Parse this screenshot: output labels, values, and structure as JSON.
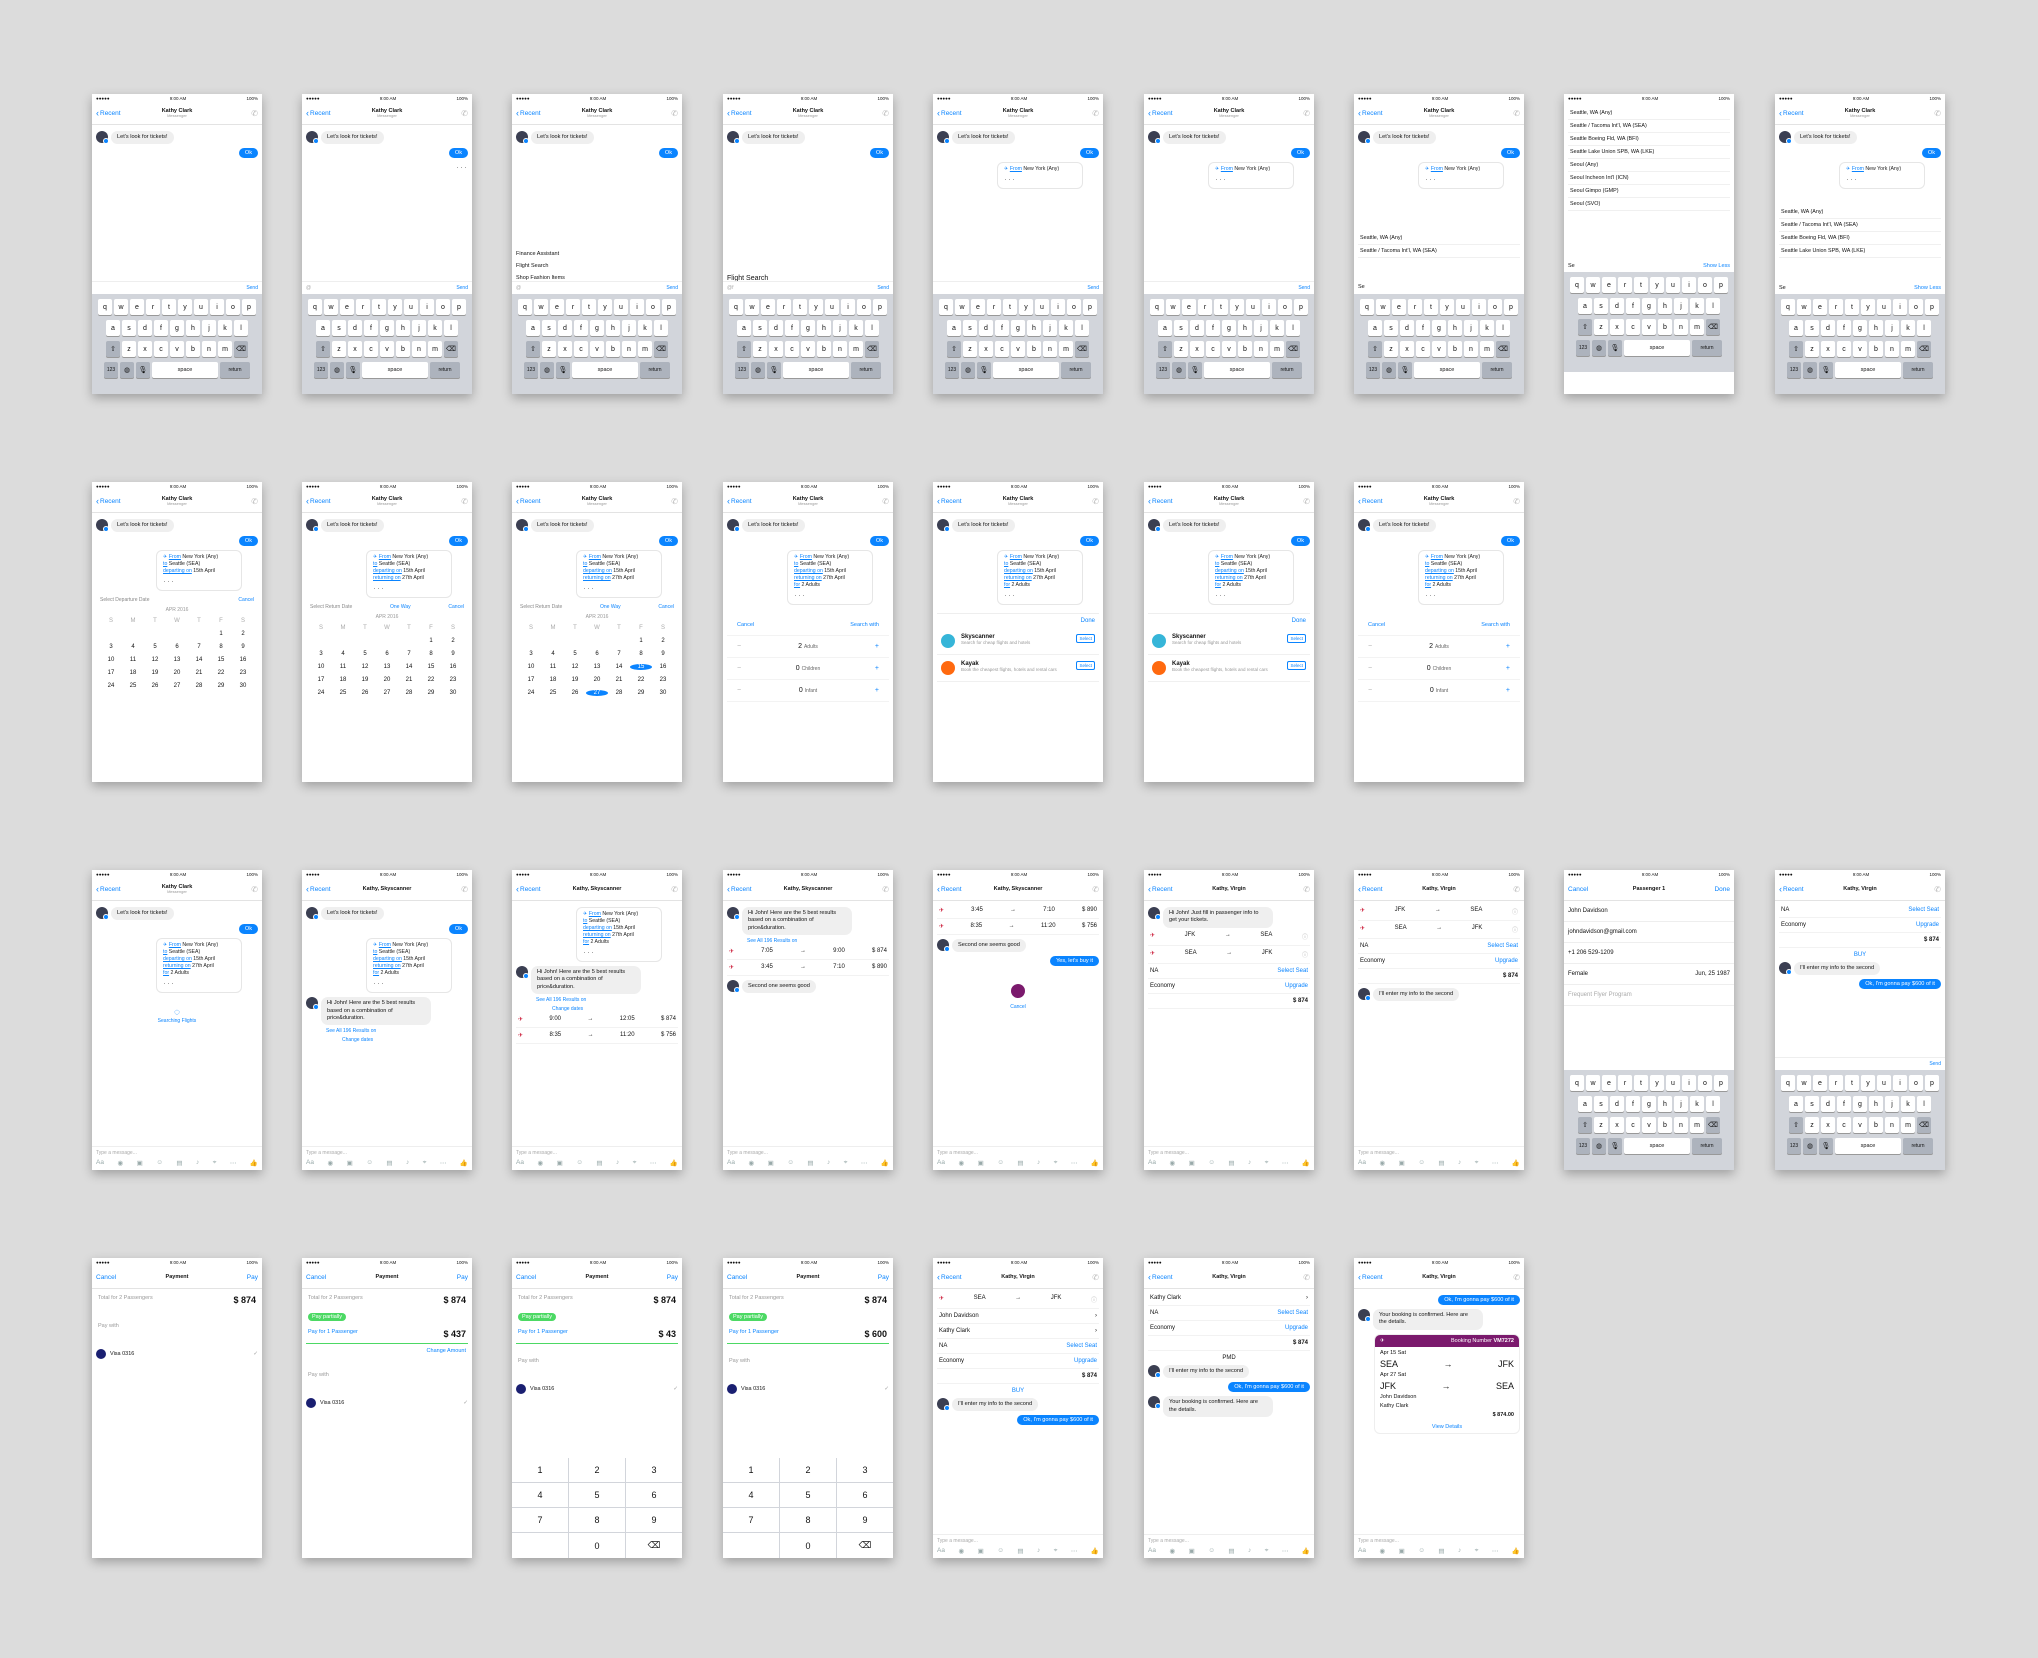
{
  "status": {
    "time": "9:00 AM",
    "battery": "100%"
  },
  "common": {
    "back": "Recent",
    "contact": "Kathy Clark",
    "contact_sub": "Messenger",
    "greeting": "Let's look for tickets!",
    "ok": "Ok",
    "send": "Send",
    "cancel": "Cancel",
    "done": "Done",
    "pay": "Pay",
    "space": "space",
    "return": "return",
    "num": "123",
    "compose_placeholder": "Type a message..."
  },
  "menu": [
    "Finance Assistant",
    "Flight Search",
    "Shop Fashion Items"
  ],
  "flight_search": "Flight Search",
  "search_card": {
    "from_label": "From",
    "from": "New York (Any)",
    "to_label": "to",
    "to": "Seattle (SEA)",
    "dep_label": "departing on",
    "dep": "15th April",
    "ret_label": "returning on",
    "ret": "27th April",
    "pax_label": "for",
    "pax": "2 Adults"
  },
  "city_input": "Se",
  "show_less": "Show Less",
  "cities": [
    "Seattle, WA (Any)",
    "Seattle / Tacoma Int'l, WA (SEA)",
    "Seattle Boeing Fld, WA (BFI)",
    "Seattle Lake Union SPB, WA (LKE)",
    "Seoul (Any)",
    "Seoul Incheon Int'l (ICN)",
    "Seoul Gimpo (GMP)",
    "Seoul (SVO)"
  ],
  "calendar": {
    "select_dep": "Select Departure Date",
    "select_ret": "Select Return Date",
    "one_way": "One Way",
    "month": "APR 2016",
    "weekdays": [
      "S",
      "M",
      "T",
      "W",
      "T",
      "F",
      "S"
    ],
    "days": [
      "",
      "",
      "",
      "",
      "",
      "1",
      "2",
      "3",
      "4",
      "5",
      "6",
      "7",
      "8",
      "9",
      "10",
      "11",
      "12",
      "13",
      "14",
      "15",
      "16",
      "17",
      "18",
      "19",
      "20",
      "21",
      "22",
      "23",
      "24",
      "25",
      "26",
      "27",
      "28",
      "29",
      "30"
    ]
  },
  "counters": [
    {
      "n": "2",
      "label": "Adults"
    },
    {
      "n": "0",
      "label": "Children"
    },
    {
      "n": "0",
      "label": "Infant"
    }
  ],
  "search_with": "Search with",
  "providers": [
    {
      "name": "Skyscanner",
      "desc": "Search for cheap flights and hotels",
      "action": "Select",
      "color": "#36b5d8"
    },
    {
      "name": "Kayak",
      "desc": "Book the cheapest flights, hotels and rental cars",
      "action": "Select",
      "color": "#ff690f"
    }
  ],
  "sky": {
    "title": "Kathy, Skyscanner",
    "searching": "Searching Flights",
    "intro": "Hi John! Here are the 5 best results based on a combination of price&duration.",
    "see_all": "See All 196 Results on",
    "change_dates": "Change dates",
    "flights": [
      {
        "dep": "9:00",
        "arr": "12:05",
        "price": "$ 874"
      },
      {
        "dep": "8:35",
        "arr": "11:20",
        "price": "$ 756"
      },
      {
        "dep": "7:05",
        "arr": "9:00",
        "price": "$ 874"
      },
      {
        "dep": "3:45",
        "arr": "7:10",
        "price": "$ 890"
      }
    ],
    "second_good": "Second one seems good",
    "buy_it": "Yes, let's buy it"
  },
  "virgin": {
    "title": "Kathy, Virgin",
    "intro": "Hi John! Just fill in passenger info to get your tickets.",
    "leg1": [
      "JFK",
      "SEA"
    ],
    "leg2": [
      "SEA",
      "JFK"
    ],
    "passengers": [
      "John Davidson",
      "Kathy Clark"
    ],
    "seat": "NA",
    "select_seat": "Select Seat",
    "economy": "Economy",
    "upgrade": "Upgrade",
    "total": "$ 874",
    "buy": "BUY",
    "entered": "I'll enter my info to the second",
    "ok_pay": "Ok, I'm gonna pay $600 of it",
    "confirmed": "Your booking is confirmed. Here are the details.",
    "booking_ref": "Booking Number",
    "booking_no": "VM7272",
    "date1": "Apr 15 Sat",
    "date2": "Apr 27 Sat",
    "view": "View Details",
    "amount": "$ 874.00",
    "pmd": "PMD"
  },
  "passenger": {
    "title": "Passenger 1",
    "name": "John Davidson",
    "email": "johndavidson@gmail.com",
    "phone": "+1 206 529-1209",
    "gender": "Female",
    "dob": "Jun, 25 1987",
    "program": "Frequent Flyer Program"
  },
  "payment": {
    "title": "Payment",
    "total_label": "Total for 2 Passengers",
    "total": "$ 874",
    "pay_partially": "Pay partially",
    "partial_amount": "$ 437",
    "partial_600": "$ 600",
    "partial_43": "$ 43",
    "for_passenger": "Pay for 1 Passenger",
    "change_amount": "Change Amount",
    "pay_with": "Pay with",
    "card": "Visa 0316",
    "keys": [
      "1",
      "2",
      "3",
      "4",
      "5",
      "6",
      "7",
      "8",
      "9",
      "",
      "0",
      "⌫"
    ]
  },
  "colors": {
    "accent": "#0a84ff",
    "virgin": "#7b1a6d"
  }
}
